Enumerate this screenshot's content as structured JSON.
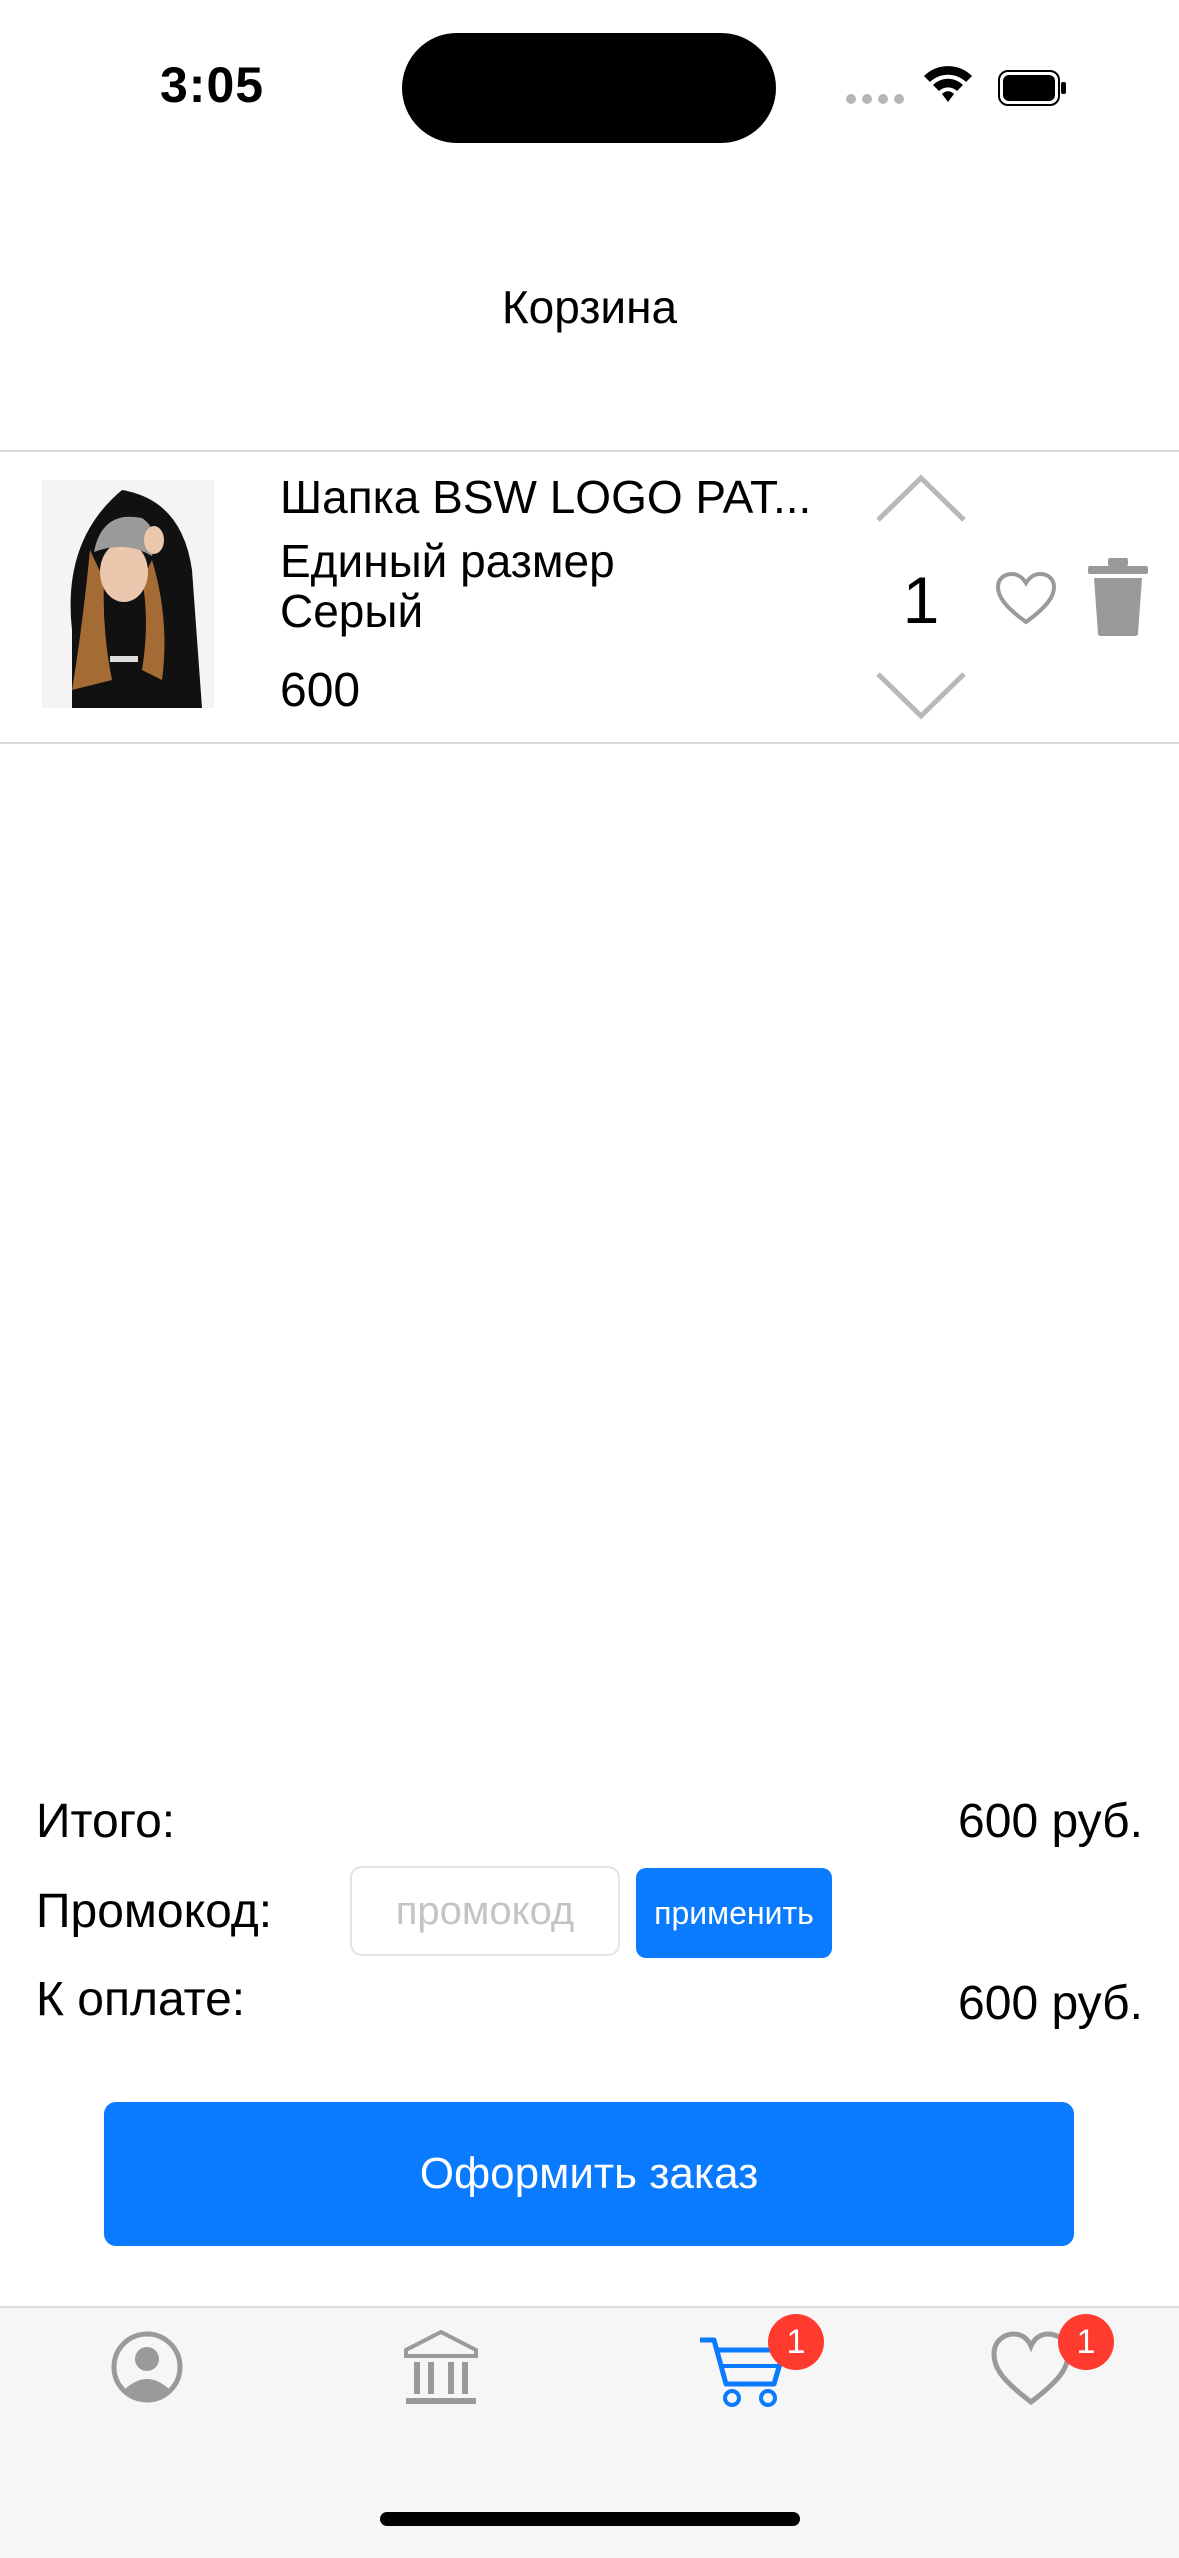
{
  "status_bar": {
    "time": "3:05"
  },
  "header": {
    "title": "Корзина"
  },
  "cart": {
    "items": [
      {
        "name": "Шапка BSW LOGO PAT...",
        "size": "Единый размер",
        "color": "Серый",
        "price": "600",
        "quantity": "1"
      }
    ]
  },
  "summary": {
    "total_label": "Итого:",
    "total_value": "600 руб.",
    "promo_label": "Промокод:",
    "promo_placeholder": "промокод",
    "promo_value": "",
    "apply_label": "применить",
    "pay_label": "К оплате:",
    "pay_value": "600 руб."
  },
  "checkout": {
    "label": "Оформить заказ"
  },
  "tabbar": {
    "tabs": [
      {
        "icon": "profile-icon",
        "badge": null
      },
      {
        "icon": "catalog-icon",
        "badge": null
      },
      {
        "icon": "cart-icon",
        "badge": "1",
        "active": true
      },
      {
        "icon": "heart-icon",
        "badge": "1"
      }
    ]
  },
  "colors": {
    "accent": "#0a7aff",
    "badge": "#ff3b30",
    "icon_gray": "#9a9a9a"
  }
}
